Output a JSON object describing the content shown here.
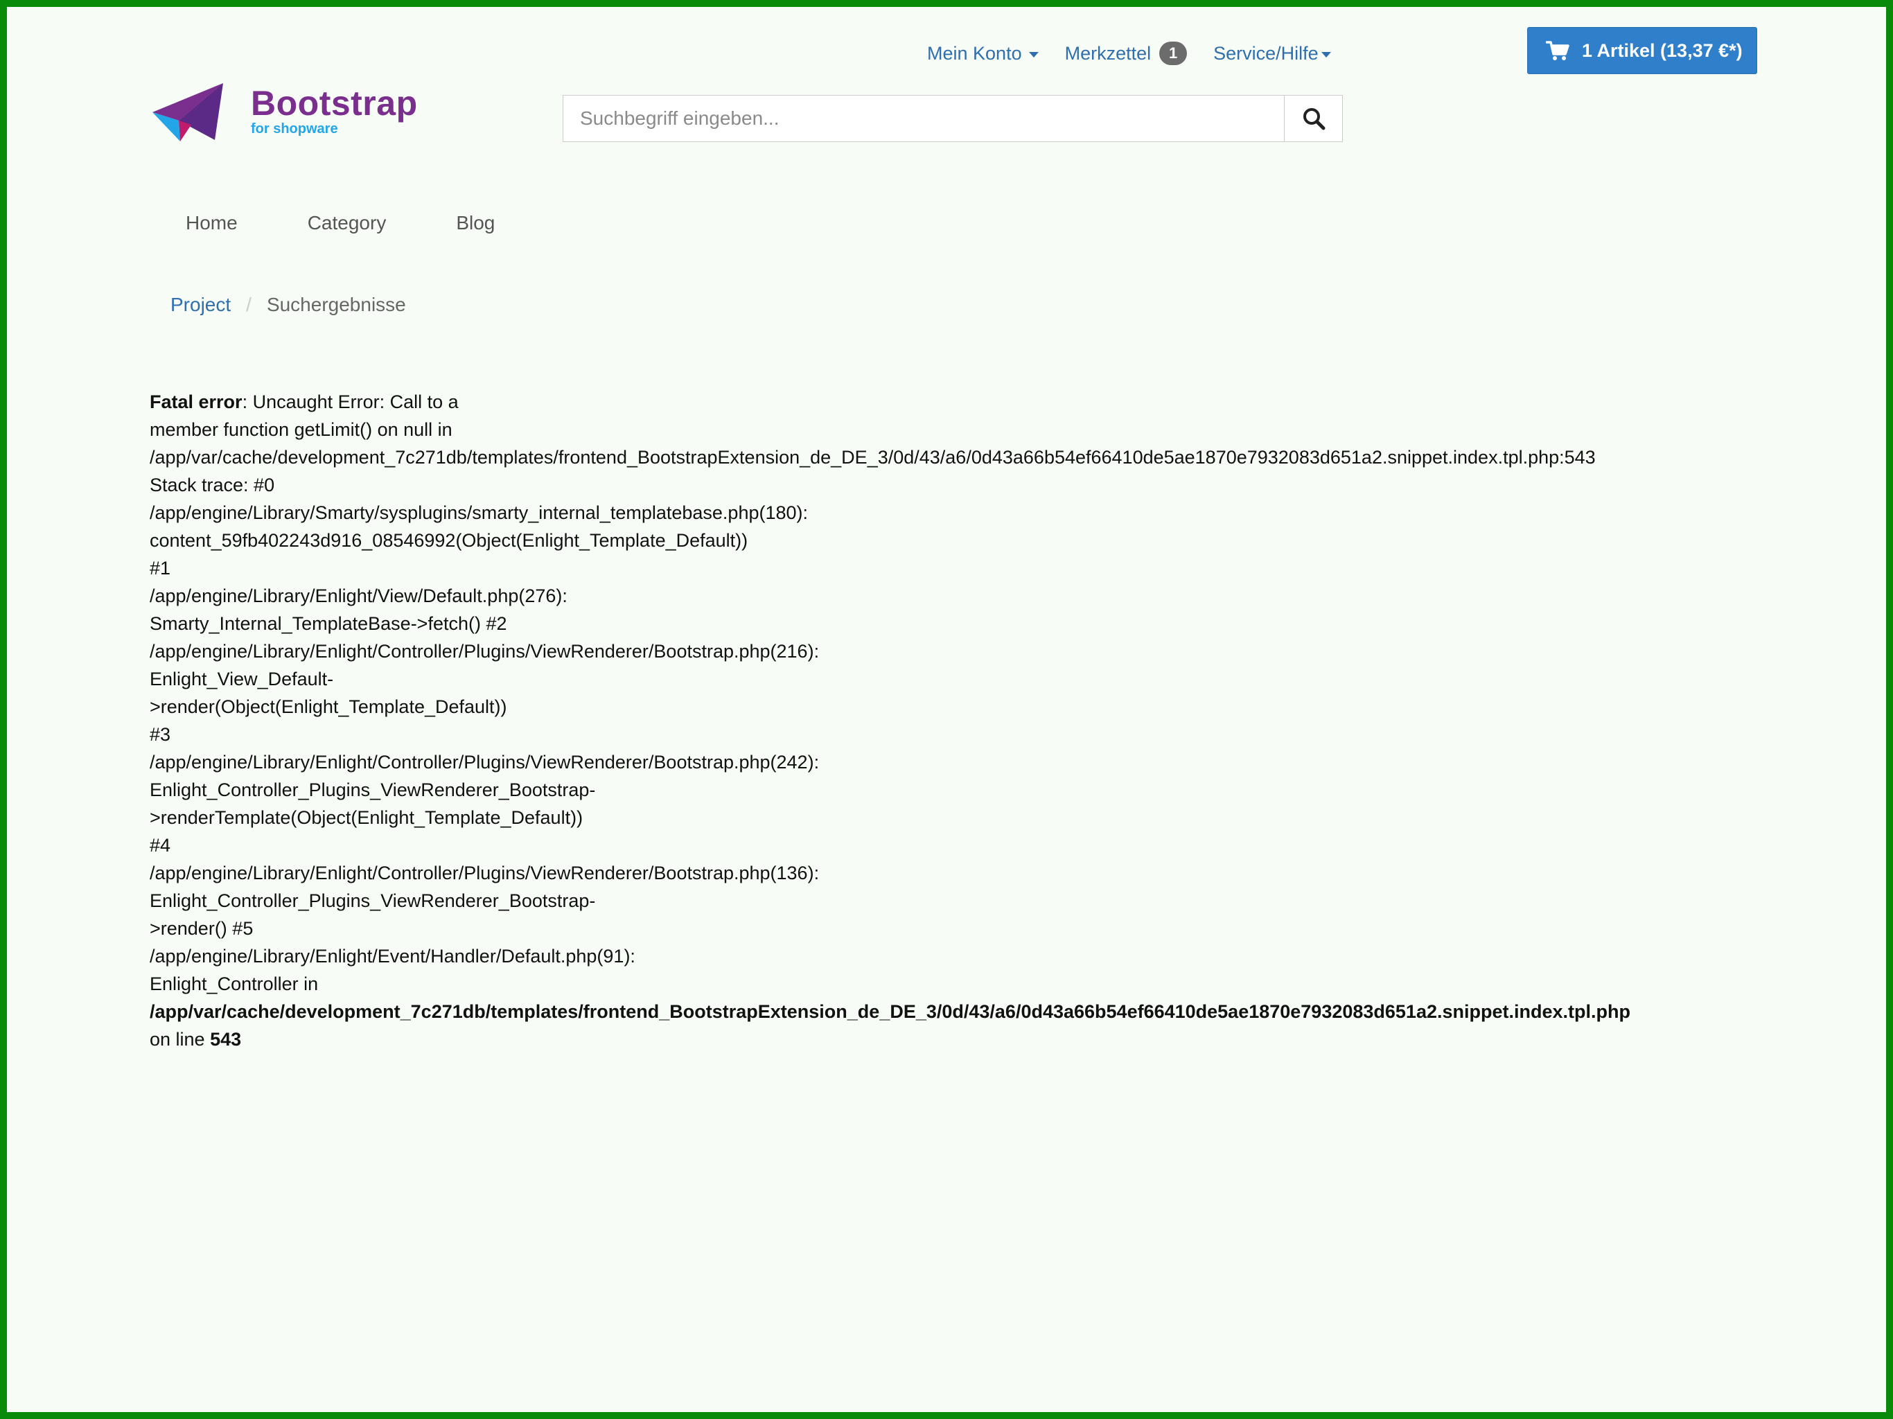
{
  "header": {
    "top_links": {
      "account_label": "Mein Konto",
      "wishlist_label": "Merkzettel",
      "wishlist_count": "1",
      "service_label": "Service/Hilfe"
    },
    "cart": {
      "label": "1 Artikel (13,37 €*)"
    },
    "logo": {
      "title": "Bootstrap",
      "subtitle": "for shopware"
    },
    "search": {
      "placeholder": "Suchbegriff eingeben..."
    }
  },
  "nav": {
    "items": [
      {
        "label": "Home"
      },
      {
        "label": "Category"
      },
      {
        "label": "Blog"
      }
    ]
  },
  "breadcrumb": {
    "items": [
      {
        "label": "Project"
      },
      {
        "label": "Suchergebnisse"
      }
    ],
    "separator": "/"
  },
  "error": {
    "title": "Fatal error",
    "line_1_rest": ": Uncaught Error: Call to a",
    "lines": [
      "member function getLimit() on null in",
      "/app/var/cache/development_7c271db/templates/frontend_BootstrapExtension_de_DE_3/0d/43/a6/0d43a66b54ef66410de5ae1870e7932083d651a2.snippet.index.tpl.php:543",
      "Stack trace: #0",
      "/app/engine/Library/Smarty/sysplugins/smarty_internal_templatebase.php(180):",
      "content_59fb402243d916_08546992(Object(Enlight_Template_Default))",
      "#1",
      "/app/engine/Library/Enlight/View/Default.php(276):",
      "Smarty_Internal_TemplateBase->fetch() #2",
      "/app/engine/Library/Enlight/Controller/Plugins/ViewRenderer/Bootstrap.php(216):",
      "Enlight_View_Default-",
      ">render(Object(Enlight_Template_Default))",
      "#3",
      "/app/engine/Library/Enlight/Controller/Plugins/ViewRenderer/Bootstrap.php(242):",
      "Enlight_Controller_Plugins_ViewRenderer_Bootstrap-",
      ">renderTemplate(Object(Enlight_Template_Default))",
      "#4",
      "/app/engine/Library/Enlight/Controller/Plugins/ViewRenderer/Bootstrap.php(136):",
      "Enlight_Controller_Plugins_ViewRenderer_Bootstrap-",
      ">render() #5",
      "/app/engine/Library/Enlight/Event/Handler/Default.php(91):",
      "Enlight_Controller in"
    ],
    "file_path": "/app/var/cache/development_7c271db/templates/frontend_BootstrapExtension_de_DE_3/0d/43/a6/0d43a66b54ef66410de5ae1870e7932083d651a2.snippet.index.tpl.php",
    "on_line_label": "on line ",
    "line_number": "543"
  },
  "colors": {
    "link": "#2f6fad",
    "cart_button": "#2f7fcb",
    "frame_border": "#0a8a0a",
    "logo_purple": "#7a2f8f",
    "logo_blue": "#23a6e8",
    "logo_pink": "#e8197d"
  },
  "icons": {
    "cart": "shopping-cart-icon",
    "search": "magnifier-icon",
    "caret": "caret-down-icon",
    "logo": "paper-plane-logo"
  }
}
